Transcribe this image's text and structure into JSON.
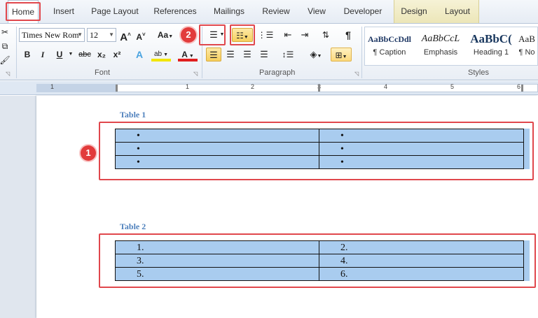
{
  "tabs": [
    "Home",
    "Insert",
    "Page Layout",
    "References",
    "Mailings",
    "Review",
    "View",
    "Developer",
    "Design",
    "Layout"
  ],
  "ribbon": {
    "font": {
      "name": "Times New Rom",
      "size": "12",
      "grow": "A",
      "shrink": "A",
      "change_case": "Aa",
      "bold": "B",
      "italic": "I",
      "underline": "U",
      "strike": "abc",
      "subscript": "x₂",
      "superscript": "x²",
      "text_effects": "A",
      "highlight": "ab",
      "font_color": "A",
      "label": "Font"
    },
    "paragraph": {
      "label": "Paragraph",
      "pilcrow": "¶"
    },
    "styles": {
      "label": "Styles",
      "items": [
        {
          "sample": "AaBbCcDdl",
          "name": "¶ Caption"
        },
        {
          "sample": "AaBbCcL",
          "name": "Emphasis"
        },
        {
          "sample": "AaBbC(",
          "name": "Heading 1"
        },
        {
          "sample": "AaB",
          "name": "¶ No"
        }
      ]
    }
  },
  "ruler": {
    "numbers": [
      "1",
      "1",
      "2",
      "3",
      "4",
      "5",
      "6"
    ]
  },
  "document": {
    "table1": {
      "caption": "Table 1",
      "rows": [
        [
          "•",
          "•"
        ],
        [
          "•",
          "•"
        ],
        [
          "•",
          "•"
        ]
      ]
    },
    "table2": {
      "caption": "Table 2",
      "rows": [
        [
          "1.",
          "2."
        ],
        [
          "3.",
          "4."
        ],
        [
          "5.",
          "6."
        ]
      ]
    }
  },
  "callouts": {
    "one": "1",
    "two": "2"
  },
  "colors": {
    "accent_red": "#e0474c",
    "cell_highlight": "#a9ccef",
    "caption_blue": "#4f81bd"
  }
}
